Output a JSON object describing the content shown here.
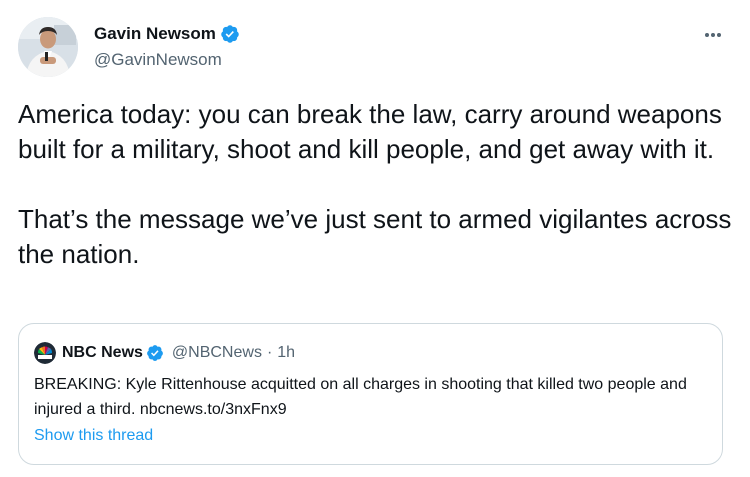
{
  "author": {
    "name": "Gavin Newsom",
    "handle": "@GavinNewsom",
    "verified": true,
    "avatar": "profile-photo"
  },
  "more_icon": "more-horizontal-icon",
  "tweet": {
    "paragraphs": [
      "America today: you can break the law, carry around weapons built for a military, shoot and kill people, and get away with it.",
      "That’s the message we’ve just sent to armed vigilantes across the nation."
    ]
  },
  "quoted_tweet": {
    "name": "NBC News",
    "handle": "@NBCNews",
    "separator": "·",
    "time": "1h",
    "verified": true,
    "logo": "nbc-peacock-logo",
    "text": "BREAKING: Kyle Rittenhouse acquitted on all charges in shooting that killed two people and injured a third. nbcnews.to/3nxFnx9",
    "show_thread": "Show this thread"
  },
  "colors": {
    "text": "#0f1419",
    "secondary": "#536471",
    "accent": "#1d9bf0",
    "border": "#cfd9de"
  }
}
